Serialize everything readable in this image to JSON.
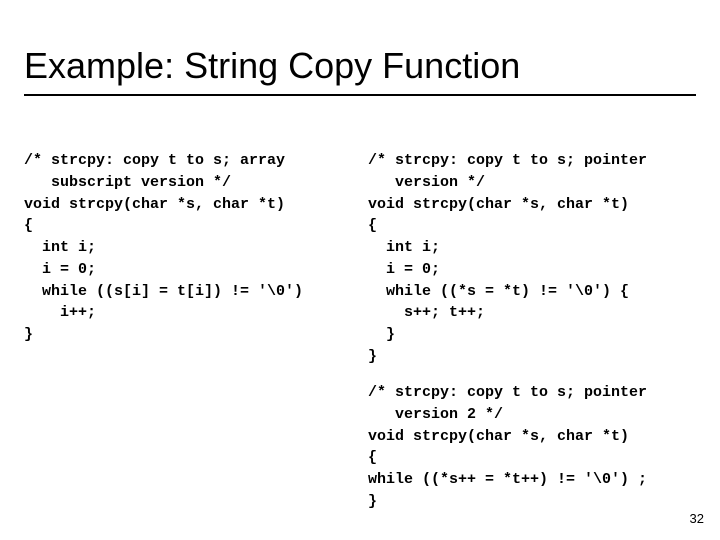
{
  "title": "Example: String Copy Function",
  "page_number": "32",
  "code_left": "/* strcpy: copy t to s; array\n   subscript version */\nvoid strcpy(char *s, char *t)\n{\n  int i;\n  i = 0;\n  while ((s[i] = t[i]) != '\\0')\n    i++;\n}",
  "code_right_1": "/* strcpy: copy t to s; pointer\n   version */\nvoid strcpy(char *s, char *t)\n{\n  int i;\n  i = 0;\n  while ((*s = *t) != '\\0') {\n    s++; t++;\n  }\n}",
  "code_right_2": "/* strcpy: copy t to s; pointer\n   version 2 */\nvoid strcpy(char *s, char *t)\n{\nwhile ((*s++ = *t++) != '\\0') ;\n}"
}
